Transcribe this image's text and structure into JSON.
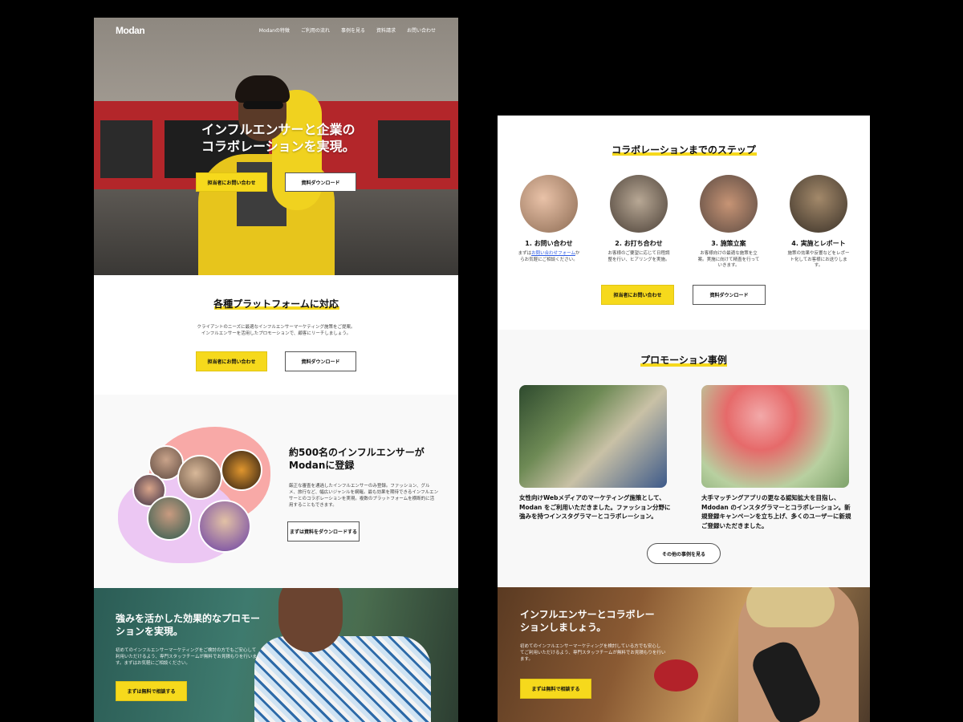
{
  "left": {
    "nav": {
      "logo": "Modan",
      "links": [
        "Modanの特徴",
        "ご利用の流れ",
        "事例を見る",
        "資料請求",
        "お問い合わせ"
      ]
    },
    "hero": {
      "title_line1": "インフルエンサーと企業の",
      "title_line2": "コラボレーションを実現。",
      "primary_btn": "担当者にお問い合わせ",
      "secondary_btn": "資料ダウンロード"
    },
    "platform": {
      "title": "各種プラットフォームに対応",
      "desc_line1": "クライアントのニーズに最適なインフルエンサーマーケティング施策をご提案。",
      "desc_line2": "インフルエンサーを活用したプロモーションで、顧客にリーチしましょう。",
      "primary_btn": "担当者にお問い合わせ",
      "secondary_btn": "資料ダウンロード"
    },
    "influencers": {
      "title_line1": "約500名のインフルエンサーが",
      "title_line2": "Modanに登録",
      "desc_line1": "厳正な審査を通過したインフルエンサーのみ登録。ファッション、グル",
      "desc_line2": "メ、旅行など、幅広いジャンルを網羅。最も効果を期待できるインフルエン",
      "desc_line3": "サーとのコラボレーションを実現。複数のプラットフォームを横断的に活",
      "desc_line4": "用することもできます。",
      "btn": "まずは資料をダウンロードする"
    },
    "cta": {
      "title_line1": "強みを活かした効果的なプロモー",
      "title_line2": "ションを実現。",
      "desc_line1": "初めてのインフルエンサーマーケティングをご検討の方でもご安心して",
      "desc_line2": "利用いただけるよう、専門スタッフチームが無料でお見積もりを行いま",
      "desc_line3": "す。まずはお気軽にご相談ください。",
      "btn": "まずは無料で相談する"
    }
  },
  "right": {
    "steps": {
      "title": "コラボレーションまでのステップ",
      "items": [
        {
          "title": "1. お問い合わせ",
          "desc_pre": "まずは",
          "desc_link": "お問い合わせフォーム",
          "desc_post": "からお気軽にご相談ください。"
        },
        {
          "title": "2. お打ち合わせ",
          "desc": "お客様のご要望に応じて日程調整を行い、ヒアリングを実施。"
        },
        {
          "title": "3. 施策立案",
          "desc": "お客様向けの最適な施策を立案。実施に向けて精査を行っていきます。"
        },
        {
          "title": "4. 実施とレポート",
          "desc": "施策の効果や反響などをレポート化してお客様にお送りします。"
        }
      ],
      "primary_btn": "担当者にお問い合わせ",
      "secondary_btn": "資料ダウンロード"
    },
    "promo": {
      "title": "プロモーション事例",
      "case1": "女性向けWebメディアのマーケティング施策として、Modan をご利用いただきました。ファッション分野に強みを持つインスタグラマーとコラボレーション。",
      "case2": "大手マッチングアプリの更なる認知拡大を目指し、Mdodan のインスタグラマーとコラボレーション。新規登録キャンペーンを立ち上げ、多くのユーザーに新規ご登録いただきました。",
      "more_btn": "その他の事例を見る"
    },
    "cta": {
      "title_line1": "インフルエンサーとコラボレー",
      "title_line2": "ションしましょう。",
      "desc_line1": "初めてのインフルエンサーマーケティングを検討している方でも安心し",
      "desc_line2": "てご利用いただけるよう、専門スタッフチームが無料でお見積もりを行い",
      "desc_line3": "ます。",
      "btn": "まずは無料で相談する"
    }
  },
  "colors": {
    "accent": "#f6d91c",
    "pink_blob": "#f8a9a7",
    "lilac_blob": "#ecc7f3",
    "link": "#2d5be3"
  }
}
